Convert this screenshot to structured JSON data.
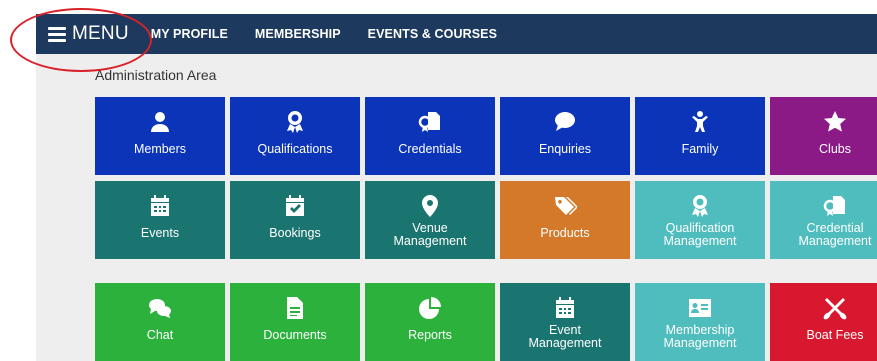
{
  "nav": {
    "menu_label": "MENU",
    "links": [
      "MY PROFILE",
      "MEMBERSHIP",
      "EVENTS & COURSES"
    ]
  },
  "area_title": "Administration Area",
  "colors": {
    "navy": "#1d3a5e",
    "blue": "#0b34b8",
    "purple": "#8c1a86",
    "teal": "#1a7470",
    "orange": "#d4782a",
    "light_teal": "#4fbcbe",
    "green": "#2cb23c",
    "red": "#d8182e"
  },
  "rows": [
    [
      {
        "label": "Members",
        "icon": "user-icon"
      },
      {
        "label": "Qualifications",
        "icon": "award-icon"
      },
      {
        "label": "Credentials",
        "icon": "certificate-icon"
      },
      {
        "label": "Enquiries",
        "icon": "speech-bubble-icon"
      },
      {
        "label": "Family",
        "icon": "child-icon"
      },
      {
        "label": "Clubs",
        "icon": "star-icon"
      }
    ],
    [
      {
        "label": "Events",
        "icon": "calendar-icon"
      },
      {
        "label": "Bookings",
        "icon": "calendar-check-icon"
      },
      {
        "label": "Venue\nManagement",
        "icon": "map-marker-icon"
      },
      {
        "label": "Products",
        "icon": "tags-icon"
      },
      {
        "label": "Qualification\nManagement",
        "icon": "award-icon"
      },
      {
        "label": "Credential\nManagement",
        "icon": "certificate-icon"
      }
    ],
    [
      {
        "label": "Chat",
        "icon": "chat-bubbles-icon"
      },
      {
        "label": "Documents",
        "icon": "document-icon"
      },
      {
        "label": "Reports",
        "icon": "pie-chart-icon"
      },
      {
        "label": "Event\nManagement",
        "icon": "calendar-icon"
      },
      {
        "label": "Membership\nManagement",
        "icon": "id-card-icon"
      },
      {
        "label": "Boat Fees",
        "icon": "crossed-oars-icon"
      }
    ]
  ]
}
